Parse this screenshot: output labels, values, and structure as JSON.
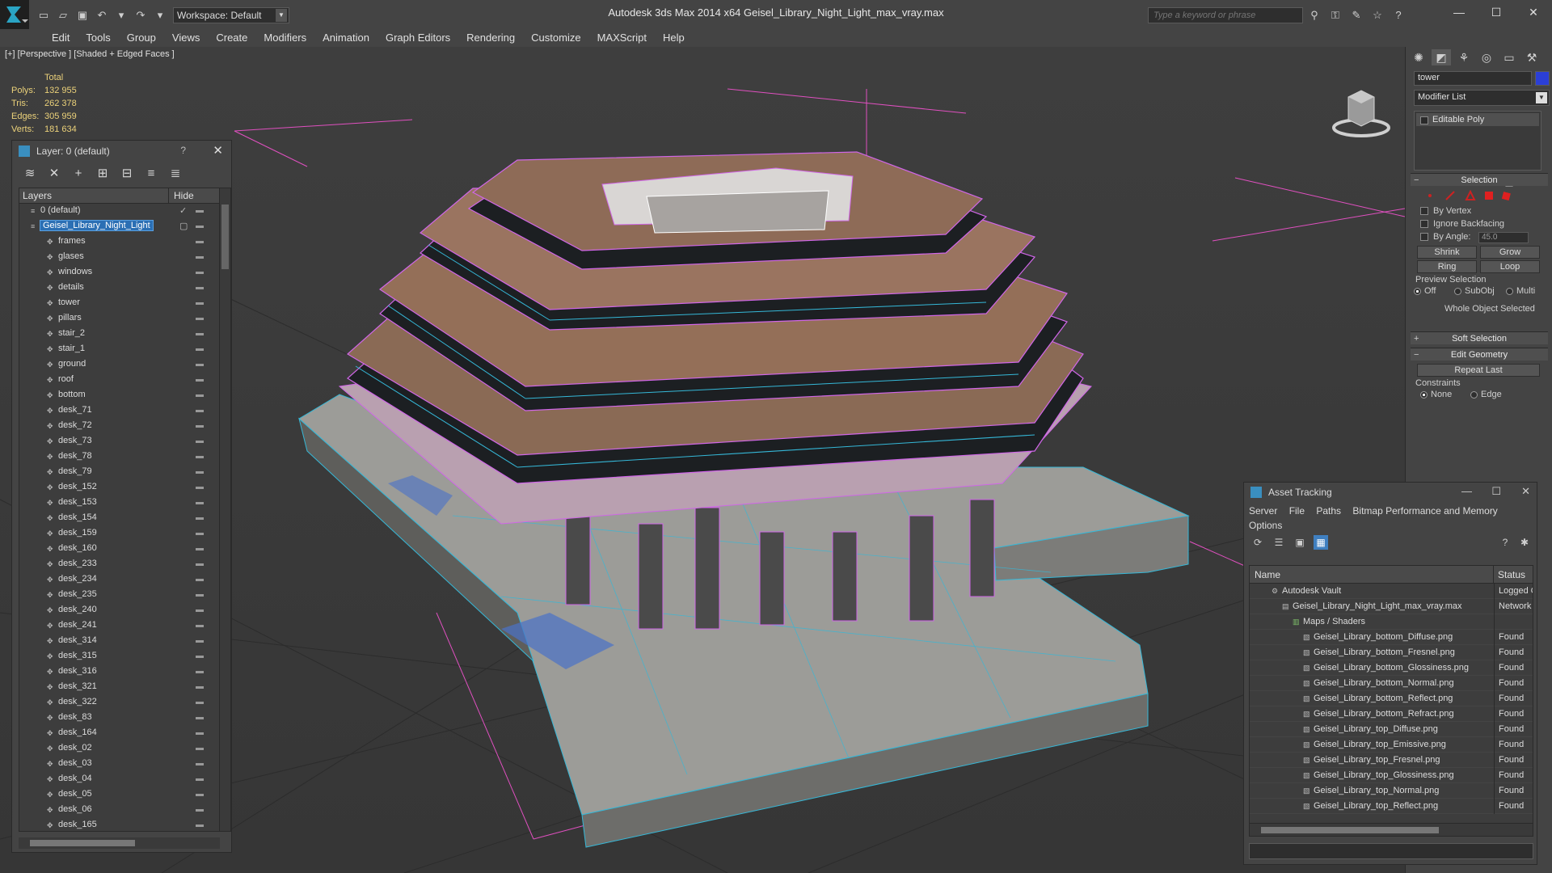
{
  "window": {
    "title": "Autodesk 3ds Max  2014 x64      Geisel_Library_Night_Light_max_vray.max",
    "workspace": "Workspace: Default",
    "search_placeholder": "Type a keyword or phrase",
    "controls": [
      "—",
      "☐",
      "✕"
    ]
  },
  "menu": [
    "Edit",
    "Tools",
    "Group",
    "Views",
    "Create",
    "Modifiers",
    "Animation",
    "Graph Editors",
    "Rendering",
    "Customize",
    "MAXScript",
    "Help"
  ],
  "viewport": {
    "label": "[+] [Perspective ] [Shaded + Edged Faces ]",
    "stats": {
      "header": "Total",
      "rows": [
        {
          "label": "Polys:",
          "value": "132 955"
        },
        {
          "label": "Tris:",
          "value": "262 378"
        },
        {
          "label": "Edges:",
          "value": "305 959"
        },
        {
          "label": "Verts:",
          "value": "181 634"
        }
      ]
    }
  },
  "layer_panel": {
    "title": "Layer: 0 (default)",
    "help": "?",
    "col_layers": "Layers",
    "col_hide": "Hide",
    "root_layers": [
      {
        "name": "0 (default)",
        "active": true
      },
      {
        "name": "Geisel_Library_Night_Light",
        "selected": true
      }
    ],
    "objects": [
      "frames",
      "glases",
      "windows",
      "details",
      "tower",
      "pillars",
      "stair_2",
      "stair_1",
      "ground",
      "roof",
      "bottom",
      "desk_71",
      "desk_72",
      "desk_73",
      "desk_78",
      "desk_79",
      "desk_152",
      "desk_153",
      "desk_154",
      "desk_159",
      "desk_160",
      "desk_233",
      "desk_234",
      "desk_235",
      "desk_240",
      "desk_241",
      "desk_314",
      "desk_315",
      "desk_316",
      "desk_321",
      "desk_322",
      "desk_83",
      "desk_164",
      "desk_02",
      "desk_03",
      "desk_04",
      "desk_05",
      "desk_06",
      "desk_165"
    ]
  },
  "command_panel": {
    "object_name": "tower",
    "object_color": "#2b3fd6",
    "modifier_list": "Modifier List",
    "stack": [
      "Editable Poly"
    ],
    "selection": {
      "title": "Selection",
      "by_vertex": "By Vertex",
      "ignore_backfacing": "Ignore Backfacing",
      "by_angle": "By Angle:",
      "angle_value": "45.0",
      "shrink": "Shrink",
      "grow": "Grow",
      "ring": "Ring",
      "loop": "Loop",
      "preview_title": "Preview Selection",
      "preview_options": [
        "Off",
        "SubObj",
        "Multi"
      ],
      "status": "Whole Object Selected"
    },
    "soft_selection": "Soft Selection",
    "edit_geometry": {
      "title": "Edit Geometry",
      "repeat_last": "Repeat Last",
      "constraints": "Constraints",
      "constraint_options": [
        "None",
        "Edge"
      ]
    }
  },
  "asset_tracking": {
    "title": "Asset Tracking",
    "menu_row1": [
      "Server",
      "File",
      "Paths",
      "Bitmap Performance and Memory"
    ],
    "menu_row2": [
      "Options"
    ],
    "col_name": "Name",
    "col_status": "Status",
    "rows": [
      {
        "name": "Autodesk Vault",
        "status": "Logged O",
        "level": 1
      },
      {
        "name": "Geisel_Library_Night_Light_max_vray.max",
        "status": "Network F",
        "level": 2
      },
      {
        "name": "Maps / Shaders",
        "status": "",
        "level": 3
      },
      {
        "name": "Geisel_Library_bottom_Diffuse.png",
        "status": "Found",
        "level": 4
      },
      {
        "name": "Geisel_Library_bottom_Fresnel.png",
        "status": "Found",
        "level": 4
      },
      {
        "name": "Geisel_Library_bottom_Glossiness.png",
        "status": "Found",
        "level": 4
      },
      {
        "name": "Geisel_Library_bottom_Normal.png",
        "status": "Found",
        "level": 4
      },
      {
        "name": "Geisel_Library_bottom_Reflect.png",
        "status": "Found",
        "level": 4
      },
      {
        "name": "Geisel_Library_bottom_Refract.png",
        "status": "Found",
        "level": 4
      },
      {
        "name": "Geisel_Library_top_Diffuse.png",
        "status": "Found",
        "level": 4
      },
      {
        "name": "Geisel_Library_top_Emissive.png",
        "status": "Found",
        "level": 4
      },
      {
        "name": "Geisel_Library_top_Fresnel.png",
        "status": "Found",
        "level": 4
      },
      {
        "name": "Geisel_Library_top_Glossiness.png",
        "status": "Found",
        "level": 4
      },
      {
        "name": "Geisel_Library_top_Normal.png",
        "status": "Found",
        "level": 4
      },
      {
        "name": "Geisel_Library_top_Reflect.png",
        "status": "Found",
        "level": 4
      }
    ]
  },
  "colors": {
    "selection_blue": "#2b6fb4",
    "wire_magenta": "#d066e8",
    "wire_cyan": "#35b8d8",
    "stats_yellow": "#ecd27a"
  }
}
